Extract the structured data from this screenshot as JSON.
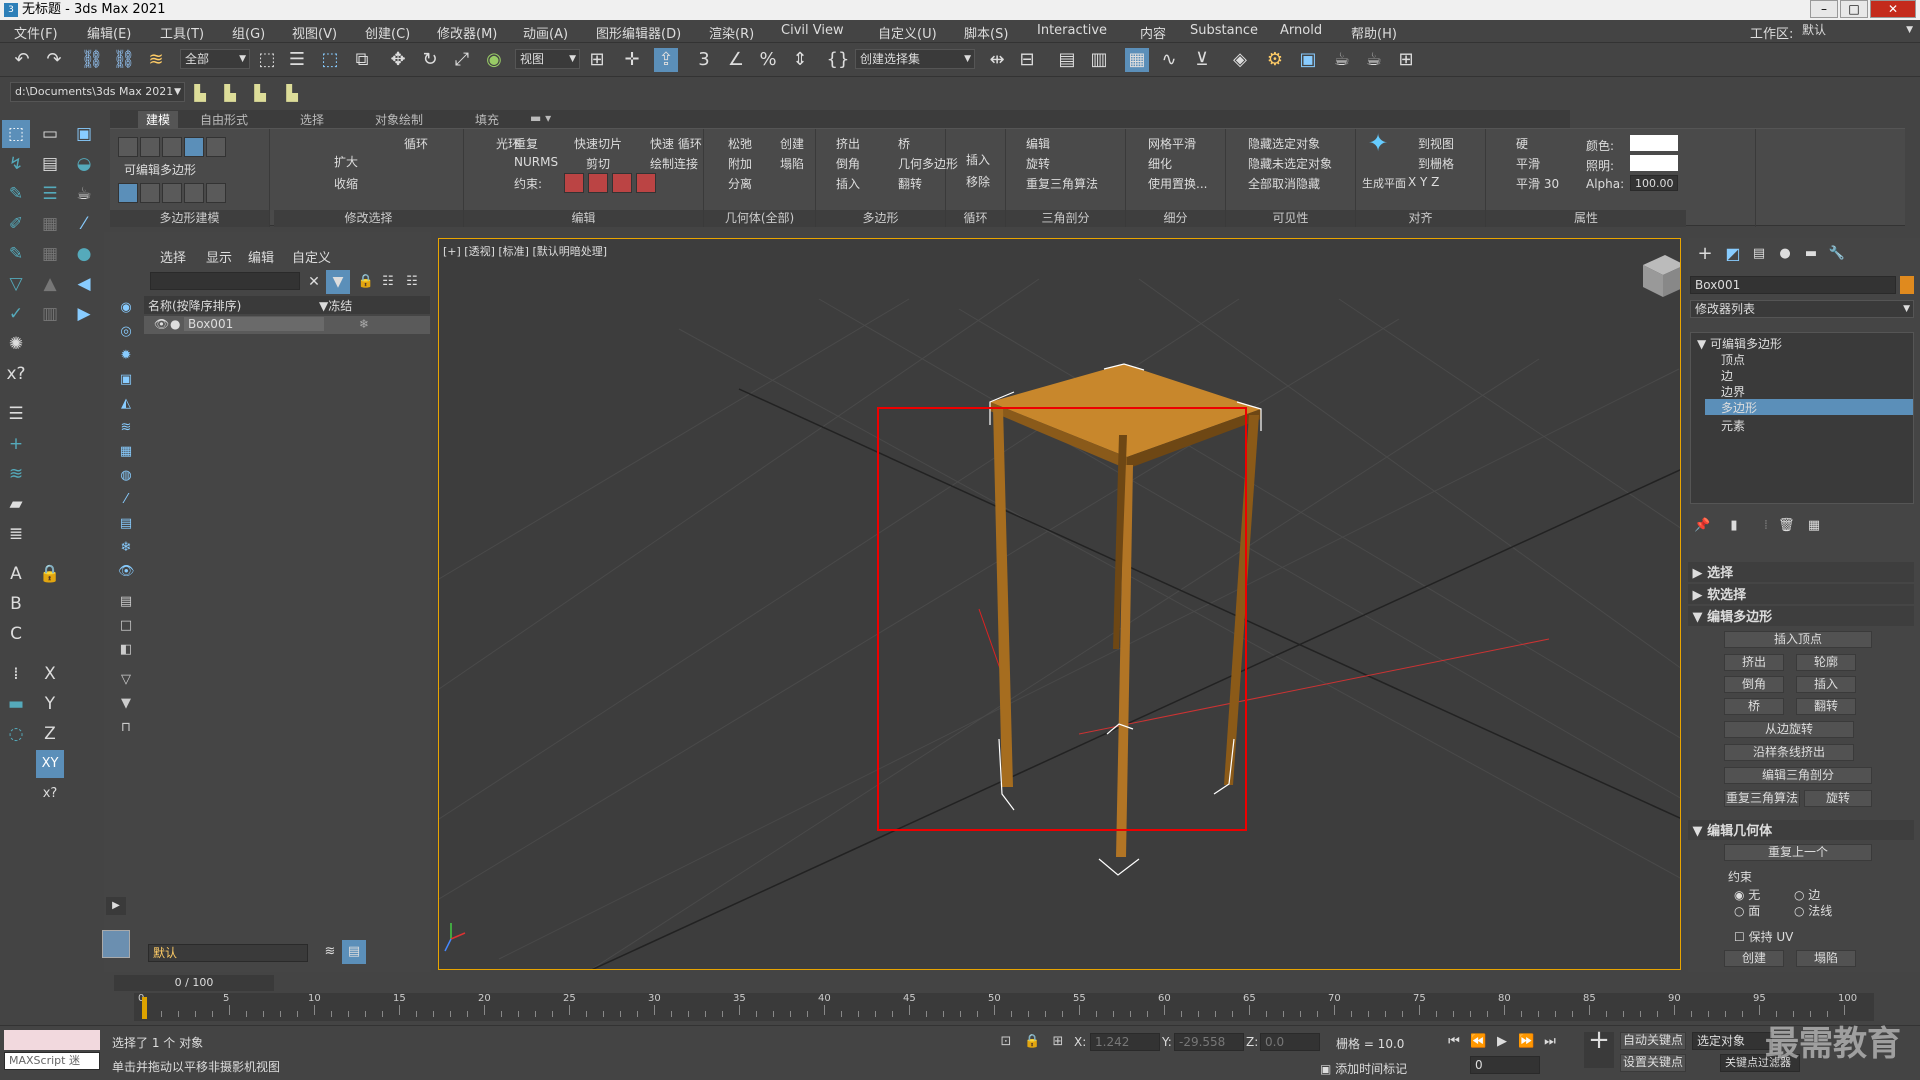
{
  "title": "无标题 - 3ds Max 2021",
  "menu": [
    "文件(F)",
    "编辑(E)",
    "工具(T)",
    "组(G)",
    "视图(V)",
    "创建(C)",
    "修改器(M)",
    "动画(A)",
    "图形编辑器(D)",
    "渲染(R)",
    "Civil View",
    "自定义(U)",
    "脚本(S)",
    "Interactive",
    "内容",
    "Substance",
    "Arnold",
    "帮助(H)"
  ],
  "workspace": {
    "label": "工作区:",
    "value": "默认"
  },
  "toolbar": {
    "filter": "全部",
    "refcoord": "视图",
    "selset": "创建选择集"
  },
  "project_path": "d:\\Documents\\3ds Max 2021",
  "ribbon_tabs": [
    "建模",
    "自由形式",
    "选择",
    "对象绘制",
    "填充"
  ],
  "ribbon": {
    "poly_model": {
      "label": "可编辑多边形",
      "footer": "多边形建模"
    },
    "mod_sel": {
      "grow": "扩大",
      "shrink": "收缩",
      "loop": "循环",
      "ring": "光环",
      "footer": "修改选择"
    },
    "edit": {
      "repeat": "重复",
      "quickslice": "快速切片",
      "quickloop": "快速 循环",
      "nurms": "NURMS",
      "cut": "剪切",
      "paintconnect": "绘制连接",
      "constraint": "约束:",
      "footer": "编辑"
    },
    "geometry": {
      "relax": "松弛",
      "create": "创建",
      "attach": "附加",
      "collapse": "塌陷",
      "detach": "分离",
      "footer": "几何体(全部)"
    },
    "polygons": {
      "extrude": "挤出",
      "bridge": "桥",
      "bevel": "倒角",
      "geopoly": "几何多边形",
      "inset": "插入",
      "flip": "翻转",
      "footer": "多边形"
    },
    "loops": {
      "insert": "插入",
      "remove": "移除",
      "footer": "循环"
    },
    "tris": {
      "edit": "编辑",
      "turn": "旋转",
      "retriangulate": "重复三角算法",
      "footer": "三角剖分"
    },
    "subdiv": {
      "meshsmooth": "网格平滑",
      "tessellate": "细化",
      "usedisp": "使用置换...",
      "footer": "细分"
    },
    "visibility": {
      "hidesel": "隐藏选定对象",
      "hideunsel": "隐藏未选定对象",
      "unhideall": "全部取消隐藏",
      "footer": "可见性"
    },
    "align": {
      "makeplanar": "生成平面",
      "toview": "到视图",
      "togrid": "到栅格",
      "footer": "对齐"
    },
    "props": {
      "hard": "硬",
      "smooth": "平滑",
      "smooth30": "平滑 30",
      "color": "颜色:",
      "illum": "照明:",
      "alpha": "Alpha:",
      "alpha_val": "100.00",
      "footer": "属性"
    }
  },
  "explorer": {
    "tabs": [
      "选择",
      "显示",
      "编辑",
      "自定义"
    ],
    "col_name": "名称(按降序排序)",
    "col_freeze": "▼冻结",
    "object": "Box001",
    "layer": "默认"
  },
  "viewport": {
    "label": "[+] [透视] [标准] [默认明暗处理]"
  },
  "cmd": {
    "objname": "Box001",
    "modlist": "修改器列表",
    "stack": [
      "可编辑多边形",
      "顶点",
      "边",
      "边界",
      "多边形",
      "元素"
    ],
    "rollouts": [
      "选择",
      "软选择",
      "编辑多边形"
    ],
    "edit_poly_btns": [
      "插入顶点",
      "挤出",
      "轮廓",
      "倒角",
      "插入",
      "桥",
      "翻转",
      "从边旋转",
      "沿样条线挤出",
      "编辑三角剖分",
      "重复三角算法",
      "旋转"
    ],
    "edit_geom": "编辑几何体",
    "repeat_last": "重复上一个",
    "constraints": "约束",
    "c_none": "无",
    "c_edge": "边",
    "c_face": "面",
    "c_normal": "法线",
    "preserve_uv": "保持 UV",
    "create": "创建",
    "collapse": "塌陷"
  },
  "timeline": {
    "frame": "0 / 100",
    "ticks": [
      "0",
      "5",
      "10",
      "15",
      "20",
      "25",
      "30",
      "35",
      "40",
      "45",
      "50",
      "55",
      "60",
      "65",
      "70",
      "75",
      "80",
      "85",
      "90",
      "95",
      "100"
    ]
  },
  "status": {
    "maxscript": "MAXScript 迷",
    "selected": "选择了 1 个 对象",
    "hint": "单击并拖动以平移非摄影机视图",
    "x_label": "X:",
    "x": "1.242",
    "y_label": "Y:",
    "y": "-29.558",
    "z_label": "Z:",
    "z": "0.0",
    "grid": "栅格 = 10.0",
    "addtime": "添加时间标记",
    "autokey": "自动关键点",
    "setkey": "设置关键点",
    "selobj": "选定对象",
    "keyfilter": "关键点过滤器",
    "frame_val": "0"
  },
  "watermark": "最需教育"
}
